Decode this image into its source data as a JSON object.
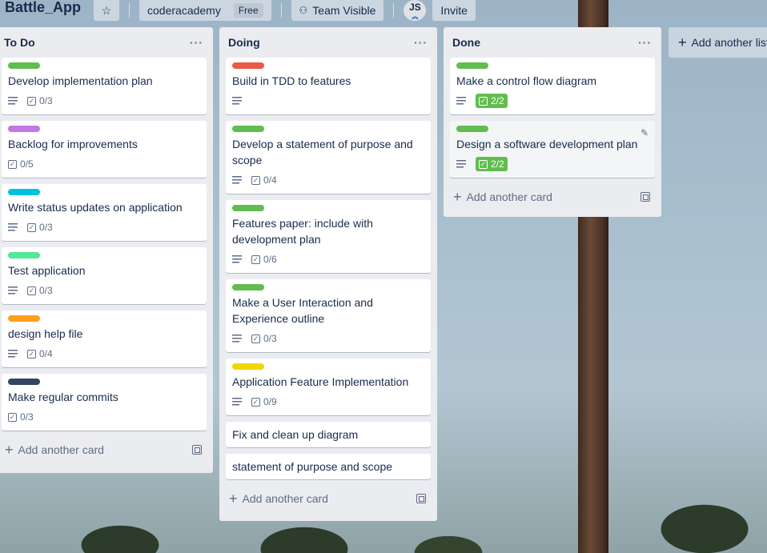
{
  "colors": {
    "green": "#61bd4f",
    "red": "#eb5a46",
    "purple": "#c377e0",
    "sky": "#00c2e0",
    "lime": "#51e898",
    "orange": "#ff9f1a",
    "black": "#344563",
    "yellow": "#f2d600"
  },
  "header": {
    "board_title": "Battle_App",
    "star_icon": "star-icon",
    "workspace": "coderacademy",
    "plan_badge": "Free",
    "visibility_icon": "team-icon",
    "visibility": "Team Visible",
    "avatar_initials": "JS",
    "invite": "Invite"
  },
  "lists": [
    {
      "title": "To Do",
      "menu": "···",
      "cards": [
        {
          "title": "Develop implementation plan",
          "label_color": "#61bd4f",
          "checklist": "0/3"
        },
        {
          "title": "Backlog for improvements",
          "label_color": "#c377e0",
          "checklist": "0/5"
        },
        {
          "title": "Write status updates on application",
          "label_color": "#00c2e0",
          "checklist": "0/3"
        },
        {
          "title": "Test application",
          "label_color": "#51e898",
          "checklist": "0/3"
        },
        {
          "title": "design help file",
          "label_color": "#ff9f1a",
          "checklist": "0/4"
        },
        {
          "title": "Make regular commits",
          "label_color": "#344563",
          "checklist": "0/3"
        }
      ],
      "add_card": "Add another card"
    },
    {
      "title": "Doing",
      "menu": "···",
      "cards": [
        {
          "title": "Build in TDD to features",
          "label_color": "#eb5a46"
        },
        {
          "title": "Develop a statement of purpose and scope",
          "label_color": "#61bd4f",
          "checklist": "0/4"
        },
        {
          "title": "Features paper: include with development plan",
          "label_color": "#61bd4f",
          "checklist": "0/6"
        },
        {
          "title": "Make a User Interaction and Experience outline",
          "label_color": "#61bd4f",
          "checklist": "0/3"
        },
        {
          "title": "Application Feature Implementation",
          "label_color": "#f2d600",
          "checklist": "0/9"
        },
        {
          "title": "Fix and clean up diagram"
        },
        {
          "title": "statement of purpose and scope"
        }
      ],
      "add_card": "Add another card"
    },
    {
      "title": "Done",
      "menu": "···",
      "cards": [
        {
          "title": "Make a control flow diagram",
          "label_color": "#61bd4f",
          "checklist": "2/2"
        },
        {
          "title": "Design a software development plan",
          "label_color": "#61bd4f",
          "checklist": "2/2"
        }
      ],
      "add_card": "Add another card"
    }
  ],
  "add_list": "Add another list"
}
